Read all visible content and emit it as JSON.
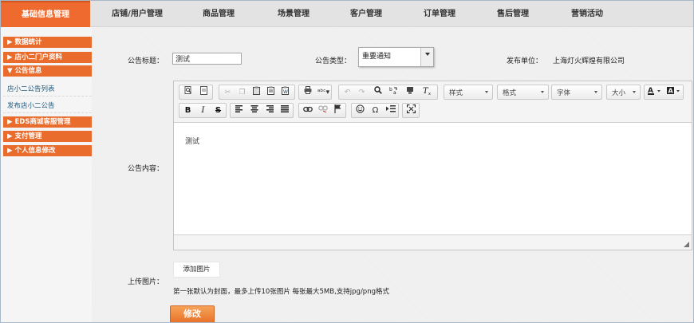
{
  "colors": {
    "accent": "#ef6a2e",
    "sidebar_group": "#ea6c2d",
    "link": "#1f5b80"
  },
  "topnav": {
    "tabs": [
      {
        "label": "基础信息管理",
        "active": true
      },
      {
        "label": "店铺/用户管理"
      },
      {
        "label": "商品管理"
      },
      {
        "label": "场景管理"
      },
      {
        "label": "客户管理"
      },
      {
        "label": "订单管理"
      },
      {
        "label": "售后管理"
      },
      {
        "label": "营销活动"
      }
    ]
  },
  "sidebar": {
    "groups": [
      {
        "label": "▶ 数据统计"
      },
      {
        "label": "▶ 店小二门户资料"
      },
      {
        "label": "▼ 公告信息"
      },
      {
        "label": "▶ EDS商城客服管理"
      },
      {
        "label": "▶ 支付管理"
      },
      {
        "label": "▶ 个人信息修改"
      }
    ],
    "links": [
      {
        "label": "店小二公告列表"
      },
      {
        "label": "发布店小二公告"
      }
    ]
  },
  "form": {
    "title_label": "公告标题：",
    "title_value": "测试",
    "type_label": "公告类型：",
    "type_value": "重要通知",
    "publisher_label": "发布单位：",
    "publisher_value": "上海灯火辉煌有限公司",
    "content_label": "公告内容：",
    "content_value": "测试",
    "upload_label": "上传图片：",
    "add_image_button": "添加图片",
    "upload_hint": "第一张默认为封面，最多上传10张图片 每张最大5MB,支持jpg/png格式",
    "submit_button": "修改"
  },
  "editor": {
    "toolbar": {
      "format_combos": [
        {
          "label": "样式"
        },
        {
          "label": "格式"
        },
        {
          "label": "字体"
        },
        {
          "label": "大小"
        }
      ],
      "icons": {
        "preview": "preview-icon",
        "templates": "templates-icon",
        "cut": "cut-icon",
        "copy": "copy-icon",
        "paste": "paste-icon",
        "paste_text": "paste-text-icon",
        "paste_word": "paste-word-icon",
        "print": "print-icon",
        "spellcheck": "spellcheck-icon",
        "undo": "undo-icon",
        "redo": "redo-icon",
        "find": "find-icon",
        "replace": "replace-icon",
        "select_all": "select-all-icon",
        "remove_format": "remove-format-icon",
        "bold": "bold-icon",
        "italic": "italic-icon",
        "strike": "strikethrough-icon",
        "align_left": "align-left-icon",
        "align_center": "align-center-icon",
        "align_right": "align-right-icon",
        "justify": "justify-icon",
        "link": "link-icon",
        "unlink": "unlink-icon",
        "anchor": "anchor-icon",
        "smiley": "smiley-icon",
        "special_char": "special-char-icon",
        "page_break": "page-break-icon",
        "maximize": "maximize-icon",
        "text_color": "text-color-icon",
        "bg_color": "bg-color-icon",
        "resize": "resize-handle-icon"
      }
    }
  }
}
